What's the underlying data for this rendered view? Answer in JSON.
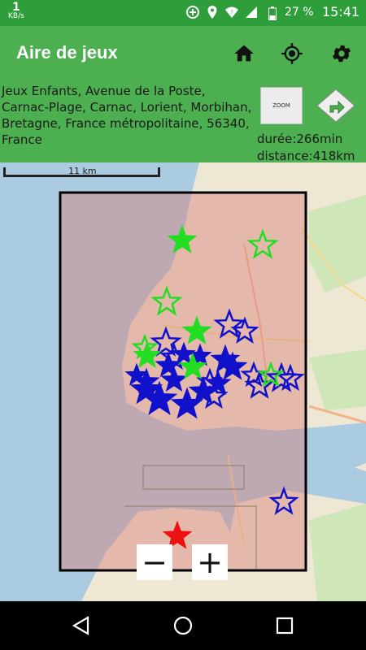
{
  "status": {
    "speed_value": "1",
    "speed_unit": "KB/s",
    "battery": "27 %",
    "time": "15:41"
  },
  "app": {
    "title": "Aire de jeux",
    "icons": [
      "home-icon",
      "locate-icon",
      "settings-icon"
    ]
  },
  "place": {
    "address": "Jeux Enfants, Avenue de la Poste, Carnac-Plage, Carnac, Lorient, Morbihan, Bretagne, France métropolitaine, 56340, France",
    "zoom_label": "ZOOM",
    "duration": "durée:266min",
    "distance": "distance:418km"
  },
  "map": {
    "scale_label": "11 km",
    "zoom_out": "−",
    "zoom_in": "+"
  },
  "colors": {
    "statusbar": "#2e9e3a",
    "appbar": "#4caf50",
    "marker_green": "#22dd22",
    "marker_blue": "#1111cc",
    "marker_red": "#ee1111"
  }
}
